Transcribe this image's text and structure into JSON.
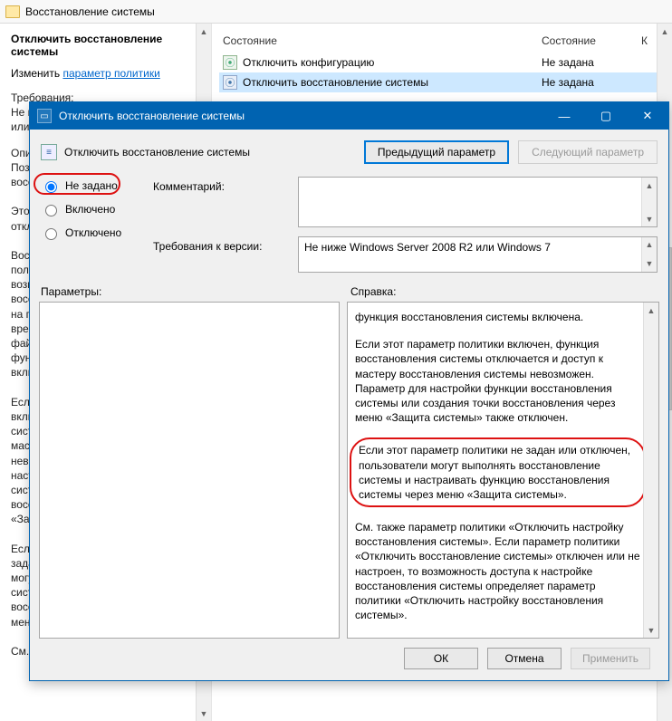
{
  "gpo": {
    "path_title": "Восстановление системы",
    "left": {
      "title": "Отключить восстановление системы",
      "edit_prefix": "Изменить ",
      "edit_link": "параметр политики",
      "req_label": "Требования:",
      "req_text": "Не ниже Windows Server 2008 R2 или Windows 7",
      "desc_label": "Описание:",
      "desc_text": "Позволяет отключить восстановление системы.\\n\\nЭтот параметр политики позволяет отключить восстановление системы.\\n\\nВосстановление системы позволяет пользователю в случае возникновения проблемы восстановить состояние компьютера на предшествующий момент времени, не теряя персональных файлов данных. По умолчанию функция восстановления системы включена.\\n\\nЕсли этот параметр политики включен, функция восстановления системы отключается и доступ к мастеру восстановления системы невозможен. Параметр для настройки функции восстановления системы или создания точки восстановления через меню «Защита системы» также отключен.\\n\\nЕсли этот параметр политики не задан или отключен, пользователи могут выполнять восстановление системы и настраивать функцию восстановления системы через меню «Защита системы».\\n\\nСм. также параметр"
    },
    "columns": {
      "c1": "Состояние",
      "c2": "Состояние",
      "c3": "К"
    },
    "rows": [
      {
        "name": "Отключить конфигурацию",
        "state": "Не задана",
        "selected": false
      },
      {
        "name": "Отключить восстановление системы",
        "state": "Не задана",
        "selected": true
      }
    ]
  },
  "dlg": {
    "title": "Отключить восстановление системы",
    "sub_title": "Отключить восстановление системы",
    "nav": {
      "prev": "Предыдущий параметр",
      "next": "Следующий параметр"
    },
    "radios": {
      "not_configured": "Не задано",
      "enabled": "Включено",
      "disabled": "Отключено",
      "selected": "not_configured"
    },
    "comment_label": "Комментарий:",
    "comment_value": "",
    "version_label": "Требования к версии:",
    "version_value": "Не ниже Windows Server 2008 R2 или Windows 7",
    "params_label": "Параметры:",
    "help_label": "Справка:",
    "help": {
      "p1": "функция восстановления системы включена.",
      "p2": "Если этот параметр политики включен, функция восстановления системы отключается и доступ к мастеру восстановления системы невозможен. Параметр для настройки функции восстановления системы или создания точки восстановления через меню «Защита системы» также отключен.",
      "p3": "Если этот параметр политики не задан или отключен, пользователи могут выполнять восстановление системы и настраивать функцию восстановления системы через меню «Защита системы».",
      "p4": "См. также параметр политики «Отключить настройку восстановления системы». Если параметр политики «Отключить восстановление системы» отключен или не настроен, то возможность доступа к настройке восстановления системы определяет параметр политики «Отключить настройку восстановления системы»."
    },
    "buttons": {
      "ok": "ОК",
      "cancel": "Отмена",
      "apply": "Применить"
    }
  }
}
